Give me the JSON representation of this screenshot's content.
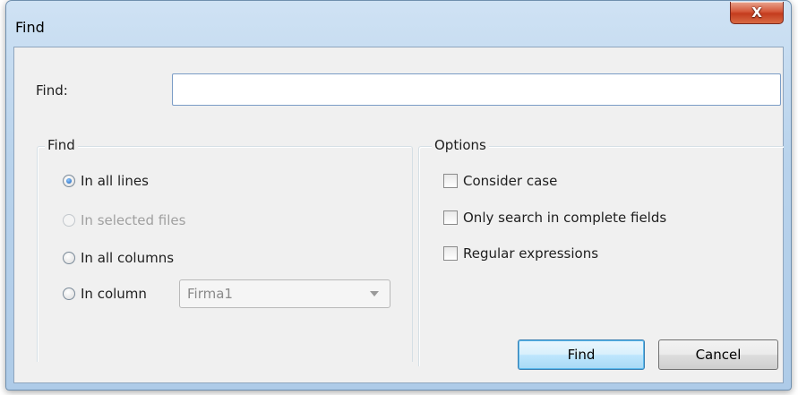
{
  "window": {
    "title": "Find",
    "close_symbol": "X"
  },
  "search": {
    "label": "Find:",
    "value": "",
    "placeholder": ""
  },
  "find_group": {
    "legend": "Find",
    "options": [
      {
        "label": "In all lines",
        "checked": true,
        "enabled": true
      },
      {
        "label": "In selected files",
        "checked": false,
        "enabled": false
      },
      {
        "label": "In all columns",
        "checked": false,
        "enabled": true
      },
      {
        "label": "In column",
        "checked": false,
        "enabled": true
      }
    ],
    "column_select": {
      "value": "Firma1"
    }
  },
  "options_group": {
    "legend": "Options",
    "checkboxes": [
      {
        "label": "Consider case",
        "checked": false
      },
      {
        "label": "Only search in complete fields",
        "checked": false
      },
      {
        "label": "Regular expressions",
        "checked": false
      }
    ]
  },
  "buttons": {
    "find": "Find",
    "cancel": "Cancel"
  }
}
